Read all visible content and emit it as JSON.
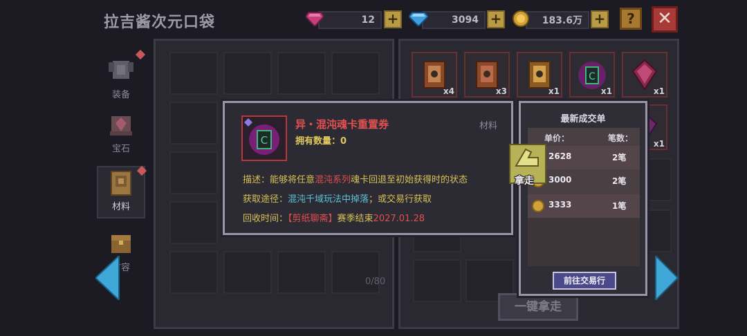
{
  "header": {
    "title": "拉吉酱次元口袋",
    "currencies": [
      {
        "name": "gem",
        "icon": "pink-gem-icon",
        "value": "12",
        "color": "#c5417e"
      },
      {
        "name": "diamond",
        "icon": "blue-diamond-icon",
        "value": "3094",
        "color": "#3f9de0"
      },
      {
        "name": "gold",
        "icon": "gold-coin-icon",
        "value": "183.6万",
        "color": "#d1a23a"
      }
    ],
    "plus_label": "+",
    "help_label": "?",
    "close_label": "✕"
  },
  "tabs": [
    {
      "label": "装备",
      "icon": "armor-icon",
      "badge": true
    },
    {
      "label": "宝石",
      "icon": "gem-chest-icon",
      "badge": false
    },
    {
      "label": "材料",
      "icon": "material-book-icon",
      "badge": true,
      "active": true
    },
    {
      "label": "扩容",
      "icon": "expand-chest-icon",
      "badge": false
    }
  ],
  "left_panel": {
    "capacity": "0/80"
  },
  "right_panel": {
    "items": [
      {
        "qty": "x4",
        "icon": "card-ticket-icon"
      },
      {
        "qty": "x3",
        "icon": "card-ticket-icon"
      },
      {
        "qty": "x1",
        "icon": "card-ticket-icon"
      },
      {
        "qty": "x1",
        "icon": "chaos-card-ticket-icon"
      },
      {
        "qty": "x1",
        "icon": "crystal-icon"
      },
      {
        "qty": "x1",
        "icon": "crystal-icon"
      }
    ],
    "take_all_label": "一键拿走"
  },
  "tooltip": {
    "name": "异・混沌魂卡重置券",
    "category": "材料",
    "own": "拥有数量：0",
    "desc_prefix": "描述：能够将任意",
    "desc_highlight": "混沌系列",
    "desc_suffix": "魂卡回退至初始获得时的状态",
    "source_prefix": "获取途径：",
    "source_highlight": "混沌千域玩法中掉落",
    "source_suffix": "；或交易行获取",
    "recycle_prefix": "回收时间：",
    "recycle_event": "【剪纸聊斋】",
    "recycle_mid": "赛季结束",
    "recycle_date": "2027.01.28"
  },
  "deals": {
    "title": "最新成交单",
    "col_price": "单价：",
    "col_count": "笔数：",
    "rows": [
      {
        "price": "2628",
        "count": "2笔"
      },
      {
        "price": "3000",
        "count": "2笔"
      },
      {
        "price": "3333",
        "count": "1笔"
      }
    ],
    "goto_label": "前往交易行"
  },
  "take_tag_label": "拿走"
}
